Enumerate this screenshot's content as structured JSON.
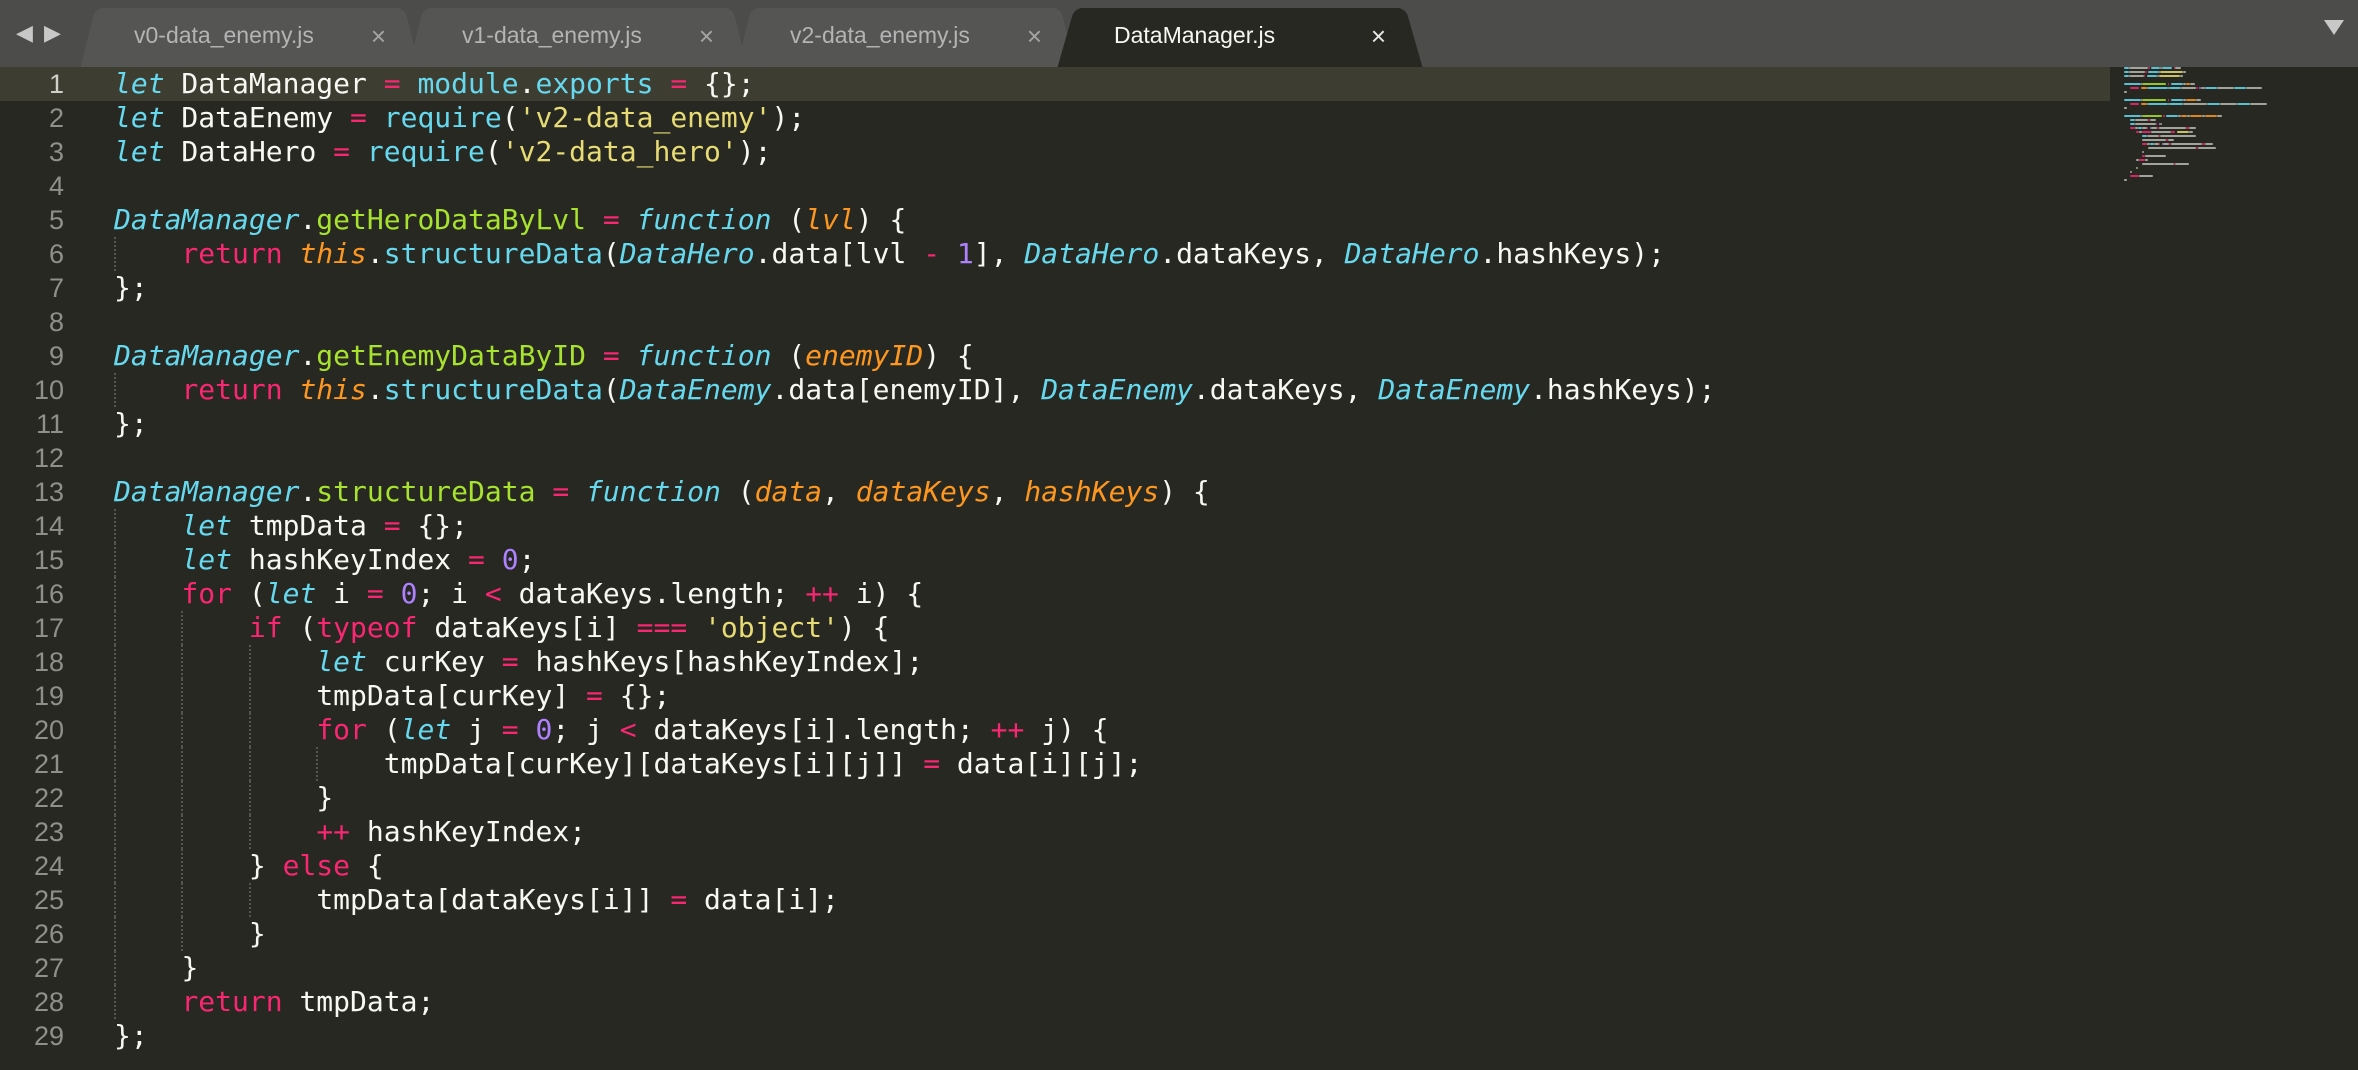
{
  "window": {
    "nav_back": "◀",
    "nav_forward": "▶",
    "menu_icon": "chevron-down-icon"
  },
  "tabs": [
    {
      "label": "v0-data_enemy.js",
      "close": "×",
      "active": false
    },
    {
      "label": "v1-data_enemy.js",
      "close": "×",
      "active": false
    },
    {
      "label": "v2-data_enemy.js",
      "close": "×",
      "active": false
    },
    {
      "label": "DataManager.js",
      "close": "×",
      "active": true
    }
  ],
  "editor": {
    "current_line": 1,
    "lines": [
      {
        "n": "1",
        "indent": 0,
        "tokens": [
          [
            "kw",
            "let"
          ],
          [
            "t",
            " DataManager "
          ],
          [
            "op",
            "="
          ],
          [
            "t",
            " "
          ],
          [
            "prop",
            "module"
          ],
          [
            "t",
            "."
          ],
          [
            "prop",
            "exports"
          ],
          [
            "t",
            " "
          ],
          [
            "op",
            "="
          ],
          [
            "t",
            " {};"
          ]
        ]
      },
      {
        "n": "2",
        "indent": 0,
        "tokens": [
          [
            "kw",
            "let"
          ],
          [
            "t",
            " DataEnemy "
          ],
          [
            "op",
            "="
          ],
          [
            "t",
            " "
          ],
          [
            "prop",
            "require"
          ],
          [
            "t",
            "("
          ],
          [
            "str",
            "'v2-data_enemy'"
          ],
          [
            "t",
            ");"
          ]
        ]
      },
      {
        "n": "3",
        "indent": 0,
        "tokens": [
          [
            "kw",
            "let"
          ],
          [
            "t",
            " DataHero "
          ],
          [
            "op",
            "="
          ],
          [
            "t",
            " "
          ],
          [
            "prop",
            "require"
          ],
          [
            "t",
            "("
          ],
          [
            "str",
            "'v2-data_hero'"
          ],
          [
            "t",
            ");"
          ]
        ]
      },
      {
        "n": "4",
        "indent": 0,
        "tokens": []
      },
      {
        "n": "5",
        "indent": 0,
        "tokens": [
          [
            "cls",
            "DataManager"
          ],
          [
            "t",
            "."
          ],
          [
            "fn",
            "getHeroDataByLvl"
          ],
          [
            "t",
            " "
          ],
          [
            "op",
            "="
          ],
          [
            "t",
            " "
          ],
          [
            "kw",
            "function"
          ],
          [
            "t",
            " ("
          ],
          [
            "prm",
            "lvl"
          ],
          [
            "t",
            ") {"
          ]
        ]
      },
      {
        "n": "6",
        "indent": 1,
        "tokens": [
          [
            "ctl",
            "return"
          ],
          [
            "t",
            " "
          ],
          [
            "ths",
            "this"
          ],
          [
            "t",
            "."
          ],
          [
            "prop",
            "structureData"
          ],
          [
            "t",
            "("
          ],
          [
            "cls",
            "DataHero"
          ],
          [
            "t",
            ".data[lvl "
          ],
          [
            "op",
            "-"
          ],
          [
            "t",
            " "
          ],
          [
            "num",
            "1"
          ],
          [
            "t",
            "], "
          ],
          [
            "cls",
            "DataHero"
          ],
          [
            "t",
            ".dataKeys, "
          ],
          [
            "cls",
            "DataHero"
          ],
          [
            "t",
            ".hashKeys);"
          ]
        ]
      },
      {
        "n": "7",
        "indent": 0,
        "tokens": [
          [
            "t",
            "};"
          ]
        ]
      },
      {
        "n": "8",
        "indent": 0,
        "tokens": []
      },
      {
        "n": "9",
        "indent": 0,
        "tokens": [
          [
            "cls",
            "DataManager"
          ],
          [
            "t",
            "."
          ],
          [
            "fn",
            "getEnemyDataByID"
          ],
          [
            "t",
            " "
          ],
          [
            "op",
            "="
          ],
          [
            "t",
            " "
          ],
          [
            "kw",
            "function"
          ],
          [
            "t",
            " ("
          ],
          [
            "prm",
            "enemyID"
          ],
          [
            "t",
            ") {"
          ]
        ]
      },
      {
        "n": "10",
        "indent": 1,
        "tokens": [
          [
            "ctl",
            "return"
          ],
          [
            "t",
            " "
          ],
          [
            "ths",
            "this"
          ],
          [
            "t",
            "."
          ],
          [
            "prop",
            "structureData"
          ],
          [
            "t",
            "("
          ],
          [
            "cls",
            "DataEnemy"
          ],
          [
            "t",
            ".data[enemyID], "
          ],
          [
            "cls",
            "DataEnemy"
          ],
          [
            "t",
            ".dataKeys, "
          ],
          [
            "cls",
            "DataEnemy"
          ],
          [
            "t",
            ".hashKeys);"
          ]
        ]
      },
      {
        "n": "11",
        "indent": 0,
        "tokens": [
          [
            "t",
            "};"
          ]
        ]
      },
      {
        "n": "12",
        "indent": 0,
        "tokens": []
      },
      {
        "n": "13",
        "indent": 0,
        "tokens": [
          [
            "cls",
            "DataManager"
          ],
          [
            "t",
            "."
          ],
          [
            "fn",
            "structureData"
          ],
          [
            "t",
            " "
          ],
          [
            "op",
            "="
          ],
          [
            "t",
            " "
          ],
          [
            "kw",
            "function"
          ],
          [
            "t",
            " ("
          ],
          [
            "prm",
            "data"
          ],
          [
            "t",
            ", "
          ],
          [
            "prm",
            "dataKeys"
          ],
          [
            "t",
            ", "
          ],
          [
            "prm",
            "hashKeys"
          ],
          [
            "t",
            ") {"
          ]
        ]
      },
      {
        "n": "14",
        "indent": 1,
        "tokens": [
          [
            "kw",
            "let"
          ],
          [
            "t",
            " tmpData "
          ],
          [
            "op",
            "="
          ],
          [
            "t",
            " {};"
          ]
        ]
      },
      {
        "n": "15",
        "indent": 1,
        "tokens": [
          [
            "kw",
            "let"
          ],
          [
            "t",
            " hashKeyIndex "
          ],
          [
            "op",
            "="
          ],
          [
            "t",
            " "
          ],
          [
            "num",
            "0"
          ],
          [
            "t",
            ";"
          ]
        ]
      },
      {
        "n": "16",
        "indent": 1,
        "tokens": [
          [
            "ctl",
            "for"
          ],
          [
            "t",
            " ("
          ],
          [
            "kw",
            "let"
          ],
          [
            "t",
            " i "
          ],
          [
            "op",
            "="
          ],
          [
            "t",
            " "
          ],
          [
            "num",
            "0"
          ],
          [
            "t",
            "; i "
          ],
          [
            "op",
            "<"
          ],
          [
            "t",
            " dataKeys.length; "
          ],
          [
            "op",
            "++"
          ],
          [
            "t",
            " i) {"
          ]
        ]
      },
      {
        "n": "17",
        "indent": 2,
        "tokens": [
          [
            "ctl",
            "if"
          ],
          [
            "t",
            " ("
          ],
          [
            "ctl",
            "typeof"
          ],
          [
            "t",
            " dataKeys[i] "
          ],
          [
            "op",
            "==="
          ],
          [
            "t",
            " "
          ],
          [
            "str",
            "'object'"
          ],
          [
            "t",
            ") {"
          ]
        ]
      },
      {
        "n": "18",
        "indent": 3,
        "tokens": [
          [
            "kw",
            "let"
          ],
          [
            "t",
            " curKey "
          ],
          [
            "op",
            "="
          ],
          [
            "t",
            " hashKeys[hashKeyIndex];"
          ]
        ]
      },
      {
        "n": "19",
        "indent": 3,
        "tokens": [
          [
            "t",
            "tmpData[curKey] "
          ],
          [
            "op",
            "="
          ],
          [
            "t",
            " {};"
          ]
        ]
      },
      {
        "n": "20",
        "indent": 3,
        "tokens": [
          [
            "ctl",
            "for"
          ],
          [
            "t",
            " ("
          ],
          [
            "kw",
            "let"
          ],
          [
            "t",
            " j "
          ],
          [
            "op",
            "="
          ],
          [
            "t",
            " "
          ],
          [
            "num",
            "0"
          ],
          [
            "t",
            "; j "
          ],
          [
            "op",
            "<"
          ],
          [
            "t",
            " dataKeys[i].length; "
          ],
          [
            "op",
            "++"
          ],
          [
            "t",
            " j) {"
          ]
        ]
      },
      {
        "n": "21",
        "indent": 4,
        "tokens": [
          [
            "t",
            "tmpData[curKey][dataKeys[i][j]] "
          ],
          [
            "op",
            "="
          ],
          [
            "t",
            " data[i][j];"
          ]
        ]
      },
      {
        "n": "22",
        "indent": 3,
        "tokens": [
          [
            "t",
            "}"
          ]
        ]
      },
      {
        "n": "23",
        "indent": 3,
        "tokens": [
          [
            "op",
            "++"
          ],
          [
            "t",
            " hashKeyIndex;"
          ]
        ]
      },
      {
        "n": "24",
        "indent": 2,
        "tokens": [
          [
            "t",
            "} "
          ],
          [
            "ctl",
            "else"
          ],
          [
            "t",
            " {"
          ]
        ]
      },
      {
        "n": "25",
        "indent": 3,
        "tokens": [
          [
            "t",
            "tmpData[dataKeys[i]] "
          ],
          [
            "op",
            "="
          ],
          [
            "t",
            " data[i];"
          ]
        ]
      },
      {
        "n": "26",
        "indent": 2,
        "tokens": [
          [
            "t",
            "}"
          ]
        ]
      },
      {
        "n": "27",
        "indent": 1,
        "tokens": [
          [
            "t",
            "}"
          ]
        ]
      },
      {
        "n": "28",
        "indent": 1,
        "tokens": [
          [
            "ctl",
            "return"
          ],
          [
            "t",
            " tmpData;"
          ]
        ]
      },
      {
        "n": "29",
        "indent": 0,
        "tokens": [
          [
            "t",
            "};"
          ]
        ]
      }
    ]
  },
  "colors": {
    "background": "#272822",
    "tabbar": "#4c4c4b",
    "keyword": "#66d9ef",
    "control": "#f92672",
    "string": "#e6db74",
    "number": "#ae81ff",
    "function": "#a6e22e",
    "parameter": "#fd971f"
  }
}
